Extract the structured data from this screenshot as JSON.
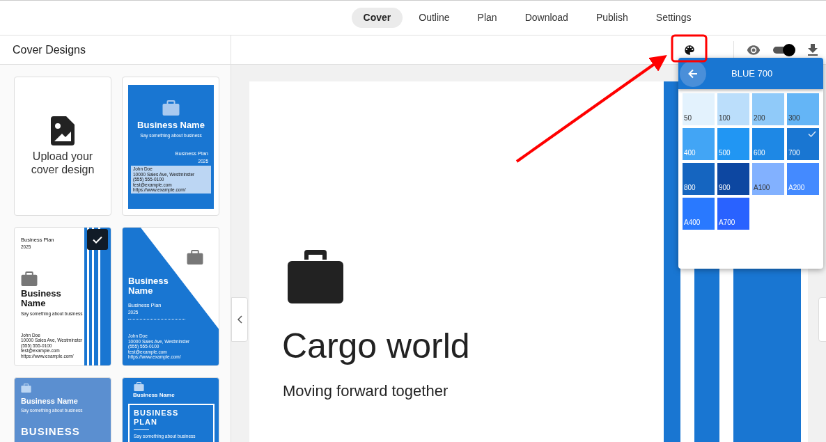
{
  "tabs": [
    {
      "label": "Cover",
      "selected": true
    },
    {
      "label": "Outline",
      "selected": false
    },
    {
      "label": "Plan",
      "selected": false
    },
    {
      "label": "Download",
      "selected": false
    },
    {
      "label": "Publish",
      "selected": false
    },
    {
      "label": "Settings",
      "selected": false
    }
  ],
  "sidebar": {
    "title": "Cover Designs",
    "upload": {
      "label": "Upload your cover design"
    },
    "templates": [
      {
        "kind": "classic",
        "selected": false,
        "business_name": "Business Name",
        "tagline": "Say something about business",
        "plan": "Business Plan",
        "year": "2025",
        "contact": [
          "John Doe",
          "10000 Sales Ave, Westminster",
          "(555) 555-0100",
          "test@example.com",
          "https://www.example.com/"
        ]
      },
      {
        "kind": "stripes",
        "selected": true,
        "business_name": "Business Name",
        "tagline": "Say something about business",
        "plan": "Business Plan",
        "year": "2025",
        "contact": [
          "John Doe",
          "10000 Sales Ave, Westminster",
          "(555) 555-0100",
          "test@example.com",
          "https://www.example.com/"
        ]
      },
      {
        "kind": "diagonal",
        "selected": false,
        "business_name": "Business Name",
        "plan": "Business Plan",
        "year": "2025",
        "contact": [
          "John Doe",
          "10000 Sales Ave, Westminster",
          "(555) 555-0100",
          "test@example.com",
          "https://www.example.com/"
        ]
      },
      {
        "kind": "photo",
        "selected": false,
        "business_name": "Business Name",
        "tagline": "Say something about business",
        "heading": "BUSINESS"
      },
      {
        "kind": "framed",
        "selected": false,
        "business_name": "Business Name",
        "heading": "BUSINESS PLAN",
        "tagline": "Say something about business"
      }
    ]
  },
  "preview": {
    "title": "Cargo world",
    "subtitle": "Moving forward together"
  },
  "toolbar": {
    "preview_toggle": {
      "on": true
    }
  },
  "color_picker": {
    "title": "BLUE 700",
    "swatches": [
      {
        "label": "50",
        "color": "#e3f2fd",
        "selected": false
      },
      {
        "label": "100",
        "color": "#bbdefb",
        "selected": false
      },
      {
        "label": "200",
        "color": "#90caf9",
        "selected": false
      },
      {
        "label": "300",
        "color": "#64b5f6",
        "selected": false
      },
      {
        "label": "400",
        "color": "#42a5f5",
        "selected": false
      },
      {
        "label": "500",
        "color": "#2196f3",
        "selected": false
      },
      {
        "label": "600",
        "color": "#1e88e5",
        "selected": false
      },
      {
        "label": "700",
        "color": "#1976d2",
        "selected": true
      },
      {
        "label": "800",
        "color": "#1565c0",
        "selected": false
      },
      {
        "label": "900",
        "color": "#0d47a1",
        "selected": false
      },
      {
        "label": "A100",
        "color": "#82b1ff",
        "selected": false
      },
      {
        "label": "A200",
        "color": "#448aff",
        "selected": false
      },
      {
        "label": "A400",
        "color": "#2979ff",
        "selected": false
      },
      {
        "label": "A700",
        "color": "#2962ff",
        "selected": false
      }
    ]
  }
}
